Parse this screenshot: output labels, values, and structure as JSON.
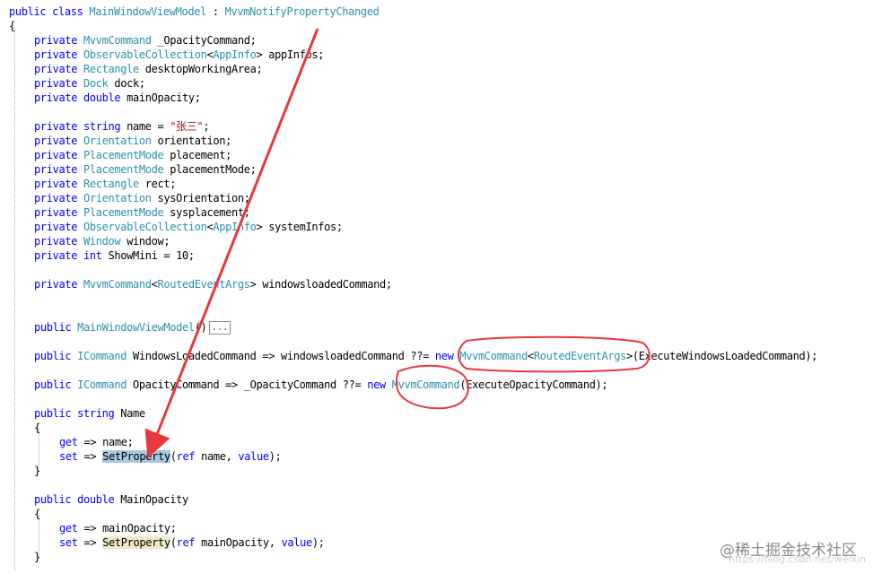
{
  "code_lines": [
    {
      "indent": 0,
      "tokens": [
        {
          "t": "public class ",
          "c": "kw"
        },
        {
          "t": "MainWindowViewModel",
          "c": "ty"
        },
        {
          "t": " : ",
          "c": "cx"
        },
        {
          "t": "MvvmNotifyPropertyChanged",
          "c": "ty"
        }
      ]
    },
    {
      "indent": 0,
      "tokens": [
        {
          "t": "{",
          "c": "cx"
        }
      ]
    },
    {
      "indent": 1,
      "tokens": [
        {
          "t": "private ",
          "c": "kw"
        },
        {
          "t": "MvvmCommand",
          "c": "ty"
        },
        {
          "t": " _OpacityCommand;",
          "c": "cx"
        }
      ]
    },
    {
      "indent": 1,
      "tokens": [
        {
          "t": "private ",
          "c": "kw"
        },
        {
          "t": "ObservableCollection",
          "c": "ty"
        },
        {
          "t": "<",
          "c": "cx"
        },
        {
          "t": "AppInfo",
          "c": "ty"
        },
        {
          "t": "> appInfos;",
          "c": "cx"
        }
      ]
    },
    {
      "indent": 1,
      "tokens": [
        {
          "t": "private ",
          "c": "kw"
        },
        {
          "t": "Rectangle",
          "c": "ty"
        },
        {
          "t": " desktopWorkingArea;",
          "c": "cx"
        }
      ]
    },
    {
      "indent": 1,
      "tokens": [
        {
          "t": "private ",
          "c": "kw"
        },
        {
          "t": "Dock",
          "c": "ty"
        },
        {
          "t": " dock;",
          "c": "cx"
        }
      ]
    },
    {
      "indent": 1,
      "tokens": [
        {
          "t": "private double ",
          "c": "kw"
        },
        {
          "t": "mainOpacity;",
          "c": "cx"
        }
      ]
    },
    {
      "indent": 0,
      "tokens": []
    },
    {
      "indent": 1,
      "tokens": [
        {
          "t": "private string ",
          "c": "kw"
        },
        {
          "t": "name = ",
          "c": "cx"
        },
        {
          "t": "\"张三\"",
          "c": "st"
        },
        {
          "t": ";",
          "c": "cx"
        }
      ]
    },
    {
      "indent": 1,
      "tokens": [
        {
          "t": "private ",
          "c": "kw"
        },
        {
          "t": "Orientation",
          "c": "ty"
        },
        {
          "t": " orientation;",
          "c": "cx"
        }
      ]
    },
    {
      "indent": 1,
      "tokens": [
        {
          "t": "private ",
          "c": "kw"
        },
        {
          "t": "PlacementMode",
          "c": "ty"
        },
        {
          "t": " placement;",
          "c": "cx"
        }
      ]
    },
    {
      "indent": 1,
      "tokens": [
        {
          "t": "private ",
          "c": "kw"
        },
        {
          "t": "PlacementMode",
          "c": "ty"
        },
        {
          "t": " placementMode;",
          "c": "cx"
        }
      ]
    },
    {
      "indent": 1,
      "tokens": [
        {
          "t": "private ",
          "c": "kw"
        },
        {
          "t": "Rectangle",
          "c": "ty"
        },
        {
          "t": " rect;",
          "c": "cx"
        }
      ]
    },
    {
      "indent": 1,
      "tokens": [
        {
          "t": "private ",
          "c": "kw"
        },
        {
          "t": "Orientation",
          "c": "ty"
        },
        {
          "t": " sysOrientation;",
          "c": "cx"
        }
      ]
    },
    {
      "indent": 1,
      "tokens": [
        {
          "t": "private ",
          "c": "kw"
        },
        {
          "t": "PlacementMode",
          "c": "ty"
        },
        {
          "t": " sysplacement;",
          "c": "cx"
        }
      ]
    },
    {
      "indent": 1,
      "tokens": [
        {
          "t": "private ",
          "c": "kw"
        },
        {
          "t": "ObservableCollection",
          "c": "ty"
        },
        {
          "t": "<",
          "c": "cx"
        },
        {
          "t": "AppInfo",
          "c": "ty"
        },
        {
          "t": "> systemInfos;",
          "c": "cx"
        }
      ]
    },
    {
      "indent": 1,
      "tokens": [
        {
          "t": "private ",
          "c": "kw"
        },
        {
          "t": "Window",
          "c": "ty"
        },
        {
          "t": " window;",
          "c": "cx"
        }
      ]
    },
    {
      "indent": 1,
      "tokens": [
        {
          "t": "private int ",
          "c": "kw"
        },
        {
          "t": "ShowMini = 10;",
          "c": "cx"
        }
      ]
    },
    {
      "indent": 0,
      "tokens": []
    },
    {
      "indent": 1,
      "tokens": [
        {
          "t": "private ",
          "c": "kw"
        },
        {
          "t": "MvvmCommand",
          "c": "ty"
        },
        {
          "t": "<",
          "c": "cx"
        },
        {
          "t": "RoutedEventArgs",
          "c": "ty"
        },
        {
          "t": "> windowsloadedCommand;",
          "c": "cx"
        }
      ]
    },
    {
      "indent": 0,
      "tokens": []
    },
    {
      "indent": 0,
      "tokens": []
    },
    {
      "indent": 1,
      "tokens": [
        {
          "t": "public ",
          "c": "kw"
        },
        {
          "t": "MainWindowViewModel",
          "c": "ty"
        },
        {
          "t": "()",
          "c": "cx"
        },
        {
          "t": "...",
          "c": "collapsed"
        }
      ]
    },
    {
      "indent": 0,
      "tokens": []
    },
    {
      "indent": 1,
      "tokens": [
        {
          "t": "public ",
          "c": "kw"
        },
        {
          "t": "ICommand",
          "c": "ty"
        },
        {
          "t": " WindowsLoadedCommand => windowsloadedCommand ??= ",
          "c": "cx"
        },
        {
          "t": "new ",
          "c": "kw"
        },
        {
          "t": "MvvmCommand",
          "c": "ty"
        },
        {
          "t": "<",
          "c": "cx"
        },
        {
          "t": "RoutedEventArgs",
          "c": "ty"
        },
        {
          "t": ">(ExecuteWindowsLoadedCommand);",
          "c": "cx"
        }
      ]
    },
    {
      "indent": 0,
      "tokens": []
    },
    {
      "indent": 1,
      "tokens": [
        {
          "t": "public ",
          "c": "kw"
        },
        {
          "t": "ICommand",
          "c": "ty"
        },
        {
          "t": " OpacityCommand => _OpacityCommand ??= ",
          "c": "cx"
        },
        {
          "t": "new ",
          "c": "kw"
        },
        {
          "t": "MvvmCommand",
          "c": "ty"
        },
        {
          "t": "(ExecuteOpacityCommand);",
          "c": "cx"
        }
      ]
    },
    {
      "indent": 0,
      "tokens": []
    },
    {
      "indent": 1,
      "tokens": [
        {
          "t": "public string ",
          "c": "kw"
        },
        {
          "t": "Name",
          "c": "cx"
        }
      ]
    },
    {
      "indent": 1,
      "tokens": [
        {
          "t": "{",
          "c": "cx"
        }
      ]
    },
    {
      "indent": 2,
      "tokens": [
        {
          "t": "get",
          "c": "kw"
        },
        {
          "t": " => name;",
          "c": "cx"
        }
      ]
    },
    {
      "indent": 2,
      "tokens": [
        {
          "t": "set",
          "c": "kw"
        },
        {
          "t": " => ",
          "c": "cx"
        },
        {
          "t": "SetProperty",
          "c": "hl"
        },
        {
          "t": "(",
          "c": "cx"
        },
        {
          "t": "ref ",
          "c": "kw"
        },
        {
          "t": "name, ",
          "c": "cx"
        },
        {
          "t": "value",
          "c": "kw"
        },
        {
          "t": ");",
          "c": "cx"
        }
      ]
    },
    {
      "indent": 1,
      "tokens": [
        {
          "t": "}",
          "c": "cx"
        }
      ]
    },
    {
      "indent": 0,
      "tokens": []
    },
    {
      "indent": 1,
      "tokens": [
        {
          "t": "public double ",
          "c": "kw"
        },
        {
          "t": "MainOpacity",
          "c": "cx"
        }
      ]
    },
    {
      "indent": 1,
      "tokens": [
        {
          "t": "{",
          "c": "cx"
        }
      ]
    },
    {
      "indent": 2,
      "tokens": [
        {
          "t": "get",
          "c": "kw"
        },
        {
          "t": " => mainOpacity;",
          "c": "cx"
        }
      ]
    },
    {
      "indent": 2,
      "tokens": [
        {
          "t": "set",
          "c": "kw"
        },
        {
          "t": " => ",
          "c": "cx"
        },
        {
          "t": "SetProperty",
          "c": "hl2"
        },
        {
          "t": "(",
          "c": "cx"
        },
        {
          "t": "ref ",
          "c": "kw"
        },
        {
          "t": "mainOpacity, ",
          "c": "cx"
        },
        {
          "t": "value",
          "c": "kw"
        },
        {
          "t": ");",
          "c": "cx"
        }
      ]
    },
    {
      "indent": 1,
      "tokens": [
        {
          "t": "}",
          "c": "cx"
        }
      ]
    }
  ],
  "colors": {
    "keyword": "#0000ff",
    "type": "#2b91af",
    "string": "#a31515",
    "annotation": "#e8383d",
    "highlight": "#a8c8e0"
  },
  "watermark": {
    "text": "@稀土掘金技术社区",
    "subtext": "https://blog.csdn.net/weixin"
  }
}
